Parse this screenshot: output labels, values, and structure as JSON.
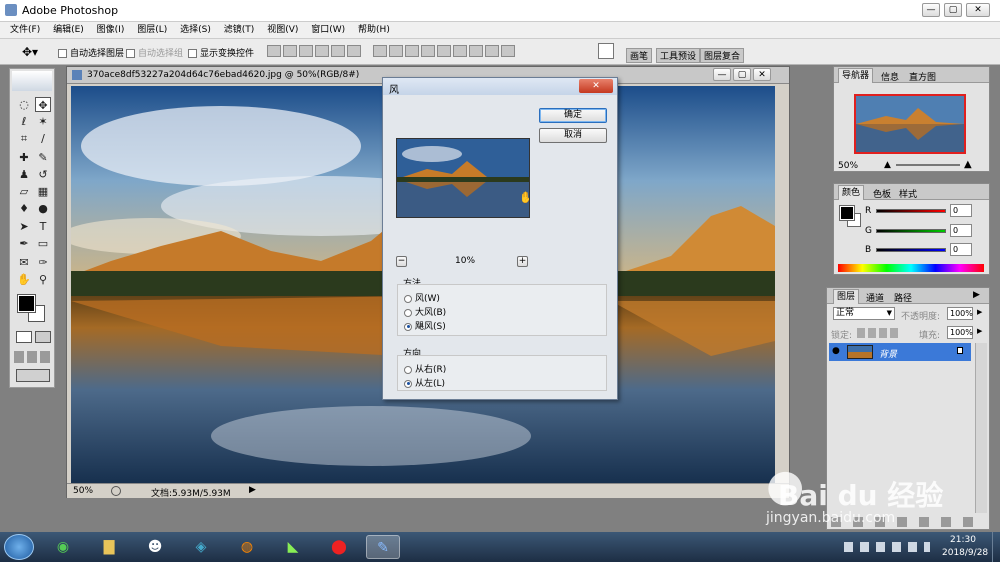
{
  "app": {
    "title": "Adobe Photoshop",
    "menus": [
      "文件(F)",
      "编辑(E)",
      "图像(I)",
      "图层(L)",
      "选择(S)",
      "滤镜(T)",
      "视图(V)",
      "窗口(W)",
      "帮助(H)"
    ]
  },
  "options": {
    "auto_select_layer": "自动选择图层",
    "auto_select_group": "自动选择组",
    "show_transform": "显示变换控件",
    "tabs": [
      "画笔",
      "工具预设",
      "图层复合"
    ]
  },
  "document": {
    "title": "370ace8df53227a204d64c76ebad4620.jpg @ 50%(RGB/8#)",
    "zoom": "50%",
    "doc_info": "文档:5.93M/5.93M"
  },
  "dialog": {
    "title": "风",
    "ok": "确定",
    "cancel": "取消",
    "zoom": "10%",
    "minus": "−",
    "plus": "+",
    "method_label": "方法",
    "methods": [
      "风(W)",
      "大风(B)",
      "飓风(S)"
    ],
    "method_selected": 2,
    "direction_label": "方向",
    "directions": [
      "从右(R)",
      "从左(L)"
    ],
    "direction_selected": 1
  },
  "navigator": {
    "tabs": [
      "导航器",
      "信息",
      "直方图"
    ],
    "zoom": "50%"
  },
  "color": {
    "tabs": [
      "颜色",
      "色板",
      "样式"
    ],
    "labels": [
      "R",
      "G",
      "B"
    ],
    "values": [
      "0",
      "0",
      "0"
    ]
  },
  "layers": {
    "tabs": [
      "图层",
      "通道",
      "路径"
    ],
    "blend_mode": "正常",
    "opacity_label": "不透明度:",
    "opacity": "100%",
    "lock_label": "锁定:",
    "fill_label": "填充:",
    "fill": "100%",
    "layer_name": "背景"
  },
  "taskbar": {
    "time": "21:30",
    "date": "2018/9/28"
  },
  "watermark": {
    "brand": "Bai du 经验",
    "url": "jingyan.baidu.com"
  }
}
